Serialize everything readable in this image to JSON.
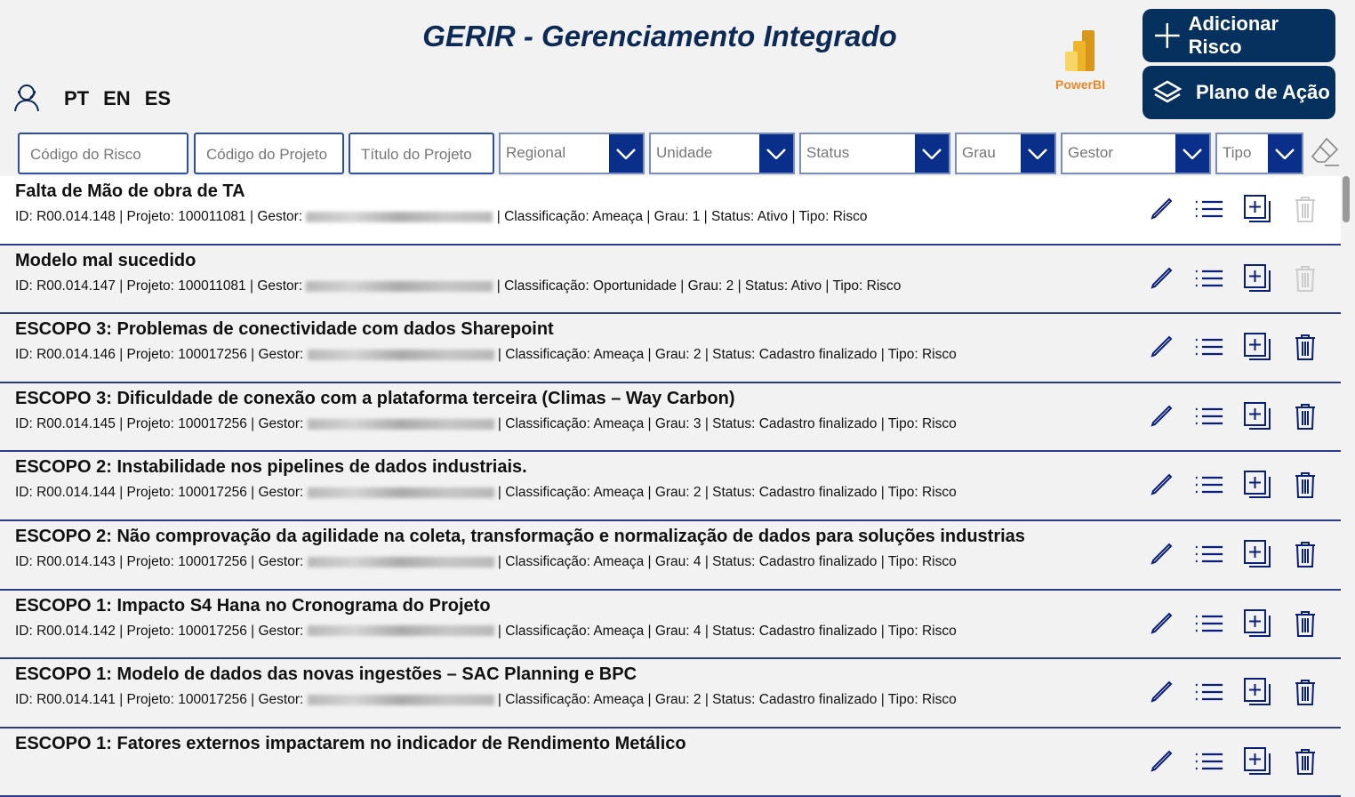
{
  "header": {
    "title": "GERIR - Gerenciamento Integrado",
    "languages": [
      "PT",
      "EN",
      "ES"
    ],
    "powerbi_label": "PowerBI",
    "add_risk": "Adicionar Risco",
    "action_plan": "Plano de Ação"
  },
  "filters": {
    "risk_code": "Código do Risco",
    "project_code": "Código do Projeto",
    "project_title": "Título do Projeto",
    "regional": "Regional",
    "unidade": "Unidade",
    "status": "Status",
    "grau": "Grau",
    "gestor": "Gestor",
    "tipo": "Tipo"
  },
  "rows": [
    {
      "title": "Falta de Mão de obra de TA",
      "pre": "ID: R00.014.148 | Projeto: 100011081 | Gestor:",
      "post": "| Classificação: Ameaça | Grau: 1 | Status: Ativo | Tipo: Risco",
      "delete_enabled": false
    },
    {
      "title": "Modelo mal sucedido",
      "pre": "ID: R00.014.147 | Projeto: 100011081 | Gestor:",
      "post": "| Classificação: Oportunidade | Grau: 2 | Status: Ativo | Tipo: Risco",
      "delete_enabled": false
    },
    {
      "title": "ESCOPO 3: Problemas de conectividade com dados Sharepoint",
      "pre": "ID: R00.014.146 | Projeto: 100017256 | Gestor:",
      "post": "| Classificação: Ameaça | Grau: 2 | Status: Cadastro finalizado | Tipo: Risco",
      "delete_enabled": true
    },
    {
      "title": "ESCOPO 3: Dificuldade de conexão com a plataforma terceira (Climas – Way Carbon)",
      "pre": "ID: R00.014.145 | Projeto: 100017256 | Gestor:",
      "post": "| Classificação: Ameaça | Grau: 3 | Status: Cadastro finalizado | Tipo: Risco",
      "delete_enabled": true
    },
    {
      "title": "ESCOPO 2: Instabilidade nos pipelines de dados industriais.",
      "pre": "ID: R00.014.144 | Projeto: 100017256 | Gestor:",
      "post": "| Classificação: Ameaça | Grau: 2 | Status: Cadastro finalizado | Tipo: Risco",
      "delete_enabled": true
    },
    {
      "title": "ESCOPO 2: Não comprovação da agilidade na coleta, transformação e normalização de dados para soluções industrias",
      "pre": "ID: R00.014.143 | Projeto: 100017256 | Gestor:",
      "post": "| Classificação: Ameaça | Grau: 4 | Status: Cadastro finalizado | Tipo: Risco",
      "delete_enabled": true
    },
    {
      "title": "ESCOPO 1: Impacto S4 Hana no Cronograma do Projeto",
      "pre": "ID: R00.014.142 | Projeto: 100017256 | Gestor:",
      "post": "| Classificação: Ameaça | Grau: 4 | Status: Cadastro finalizado | Tipo: Risco",
      "delete_enabled": true
    },
    {
      "title": "ESCOPO 1: Modelo de dados das novas ingestões – SAC Planning e BPC",
      "pre": "ID: R00.014.141 | Projeto: 100017256 | Gestor:",
      "post": "| Classificação: Ameaça | Grau: 2 | Status: Cadastro finalizado | Tipo: Risco",
      "delete_enabled": true
    },
    {
      "title": "ESCOPO 1: Fatores externos impactarem no indicador de Rendimento Metálico",
      "pre": "",
      "post": "",
      "delete_enabled": true
    }
  ]
}
